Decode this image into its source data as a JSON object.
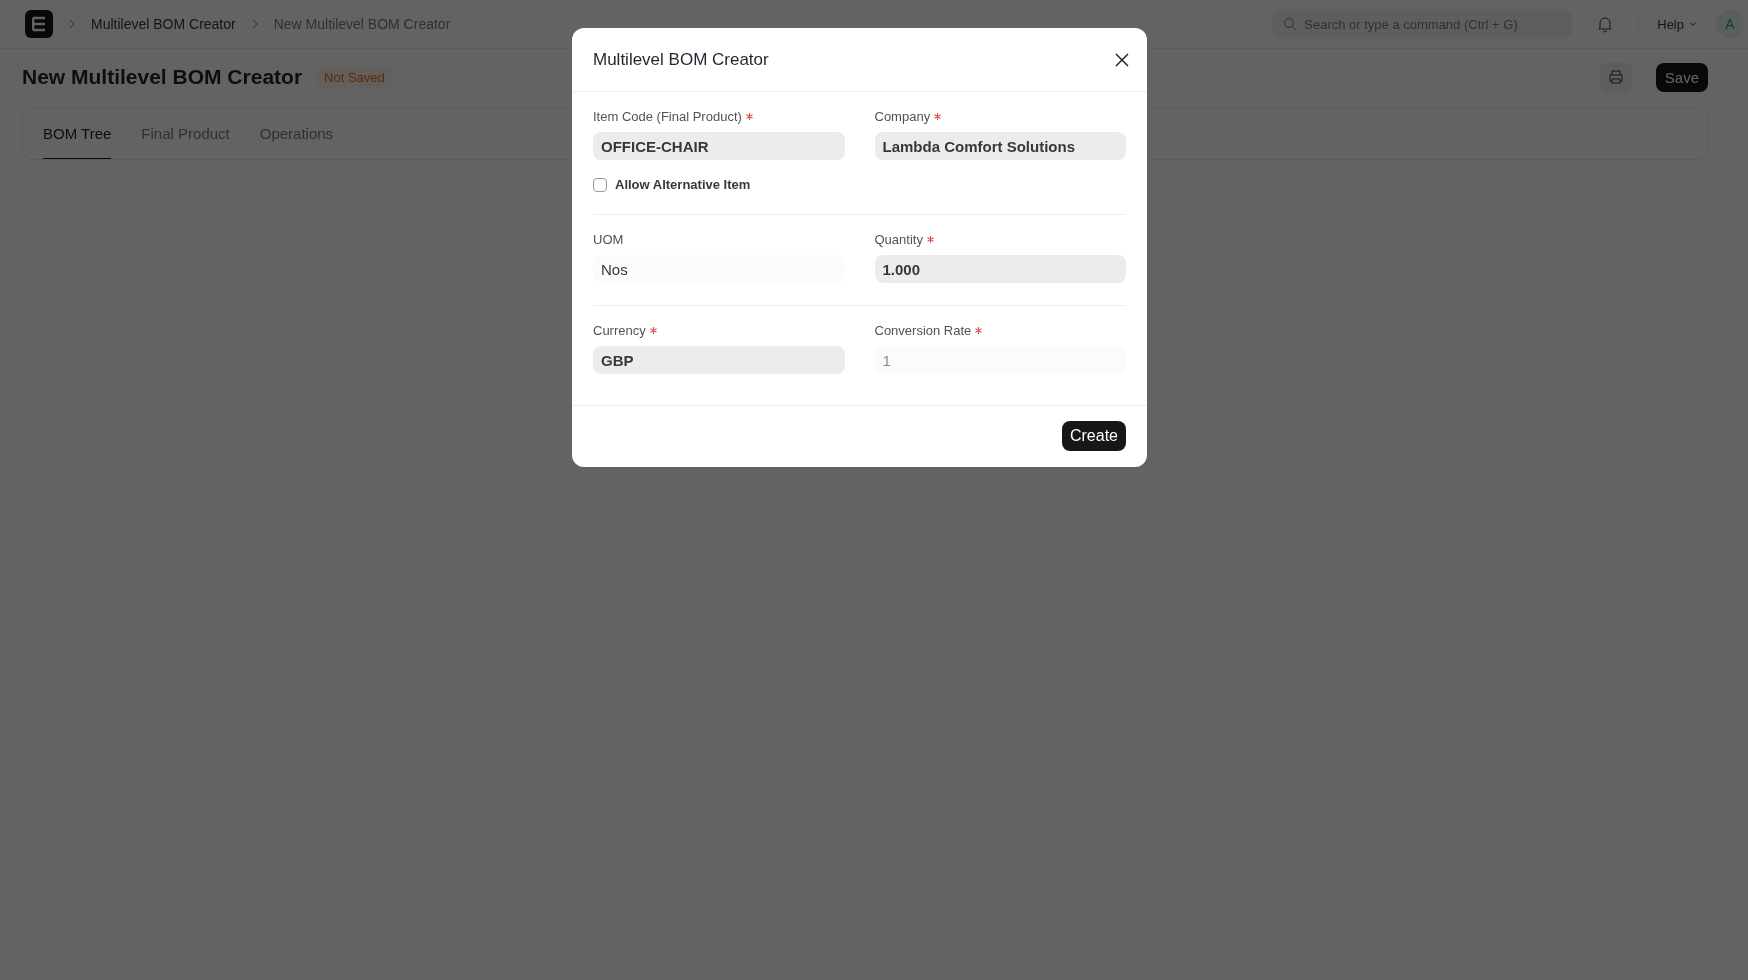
{
  "navbar": {
    "breadcrumbs": [
      "Multilevel BOM Creator",
      "New Multilevel BOM Creator"
    ],
    "search": {
      "placeholder": "Search or type a command (Ctrl + G)"
    },
    "help": "Help",
    "avatar": "A"
  },
  "page": {
    "title": "New Multilevel BOM Creator",
    "status": "Not Saved",
    "save": "Save"
  },
  "tabs": [
    {
      "label": "BOM Tree",
      "selected": true
    },
    {
      "label": "Final Product",
      "selected": false
    },
    {
      "label": "Operations",
      "selected": false
    }
  ],
  "dialog": {
    "title": "Multilevel BOM Creator",
    "sections": [
      {
        "fields": [
          {
            "label": "Item Code (Final Product)",
            "required": true,
            "value": "OFFICE-CHAIR",
            "strong": true,
            "readonly": false
          },
          {
            "label": "Company",
            "required": true,
            "value": "Lambda Comfort Solutions",
            "strong": true,
            "readonly": false
          }
        ],
        "checkbox": {
          "label": "Allow Alternative Item",
          "checked": false
        }
      },
      {
        "fields": [
          {
            "label": "UOM",
            "required": false,
            "value": "Nos",
            "strong": false,
            "readonly": true
          },
          {
            "label": "Quantity",
            "required": true,
            "value": "1.000",
            "strong": true,
            "readonly": false
          }
        ]
      },
      {
        "fields": [
          {
            "label": "Currency",
            "required": true,
            "value": "GBP",
            "strong": true,
            "readonly": false
          },
          {
            "label": "Conversion Rate",
            "required": true,
            "value": "1",
            "strong": false,
            "readonly": true
          }
        ]
      }
    ],
    "primary": "Create"
  }
}
